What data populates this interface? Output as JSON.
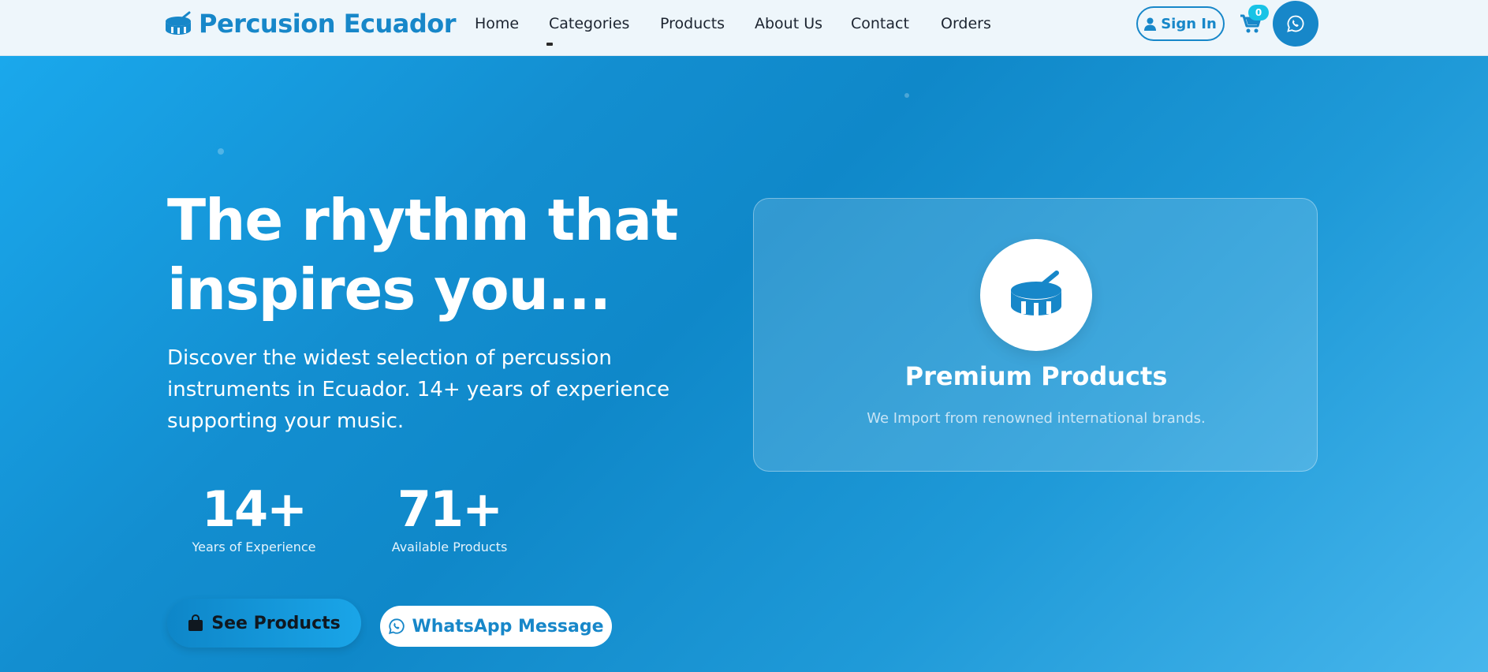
{
  "header": {
    "brand": "Percusion Ecuador",
    "nav": [
      "Home",
      "Categories",
      "Products",
      "About Us",
      "Contact",
      "Orders"
    ],
    "sign_in": "Sign In",
    "cart_count": "0"
  },
  "hero": {
    "title_line1": "The rhythm that",
    "title_line2": "inspires you...",
    "description": "Discover the widest selection of percussion instruments in Ecuador. 14+ years of experience supporting your music.",
    "stats": [
      {
        "value": "14+",
        "label": "Years of Experience"
      },
      {
        "value": "71+",
        "label": "Available Products"
      }
    ],
    "see_products": "See Products",
    "whatsapp_message": "WhatsApp Message",
    "card": {
      "title": "Premium Products",
      "subtitle": "We Import from renowned international brands."
    }
  },
  "colors": {
    "brand_blue": "#1787c9",
    "hero_gradient_start": "#1aa8ec",
    "hero_gradient_end": "#47b6ec",
    "badge": "#19c3e6",
    "header_bg": "#eef6fb"
  },
  "icons": [
    "drum-icon",
    "user-icon",
    "cart-icon",
    "whatsapp-icon",
    "shopping-bag-icon"
  ]
}
